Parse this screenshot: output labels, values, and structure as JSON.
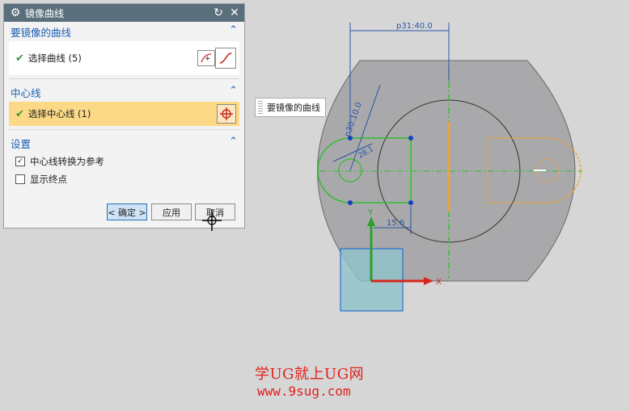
{
  "dialog": {
    "title": "镜像曲线",
    "sections": {
      "curve": {
        "header": "要镜像的曲线",
        "row_label": "选择曲线 (5)"
      },
      "centerline": {
        "header": "中心线",
        "row_label": "选择中心线 (1)"
      },
      "settings": {
        "header": "设置",
        "option1": "中心线转换为参考",
        "option1_checked": true,
        "option2": "显示终点",
        "option2_checked": false
      }
    },
    "buttons": {
      "ok": "< 确定 >",
      "apply": "应用",
      "cancel": "取消"
    }
  },
  "canvas": {
    "callout": "要镜像的曲线",
    "dim_top": "p31:40.0",
    "dim_diameter": "p30:10.0",
    "dim_small": "28.1",
    "dim_bottom": "15.6",
    "axis_x": "X",
    "axis_y": "Y"
  },
  "watermark": {
    "line1": "学UG就上UG网",
    "line2": "www.9sug.com"
  },
  "colors": {
    "title_bar": "#5a6f7c",
    "section_header": "#1a5fb4",
    "selected_row": "#fbd987",
    "part_fill": "#a9a9ab",
    "mirror_curve": "#f2a23a",
    "source_curve": "#2fbf2f",
    "dimension": "#2a55a8",
    "watermark": "#e0201c"
  },
  "icons": {
    "dialog": "gear-icon",
    "reset": "reset-icon",
    "close": "close-icon",
    "check": "check-icon",
    "collapse": "chevron-up-icon",
    "select_curve": "curve-select-icon",
    "curve": "curve-icon",
    "crosshair": "crosshair-icon"
  }
}
